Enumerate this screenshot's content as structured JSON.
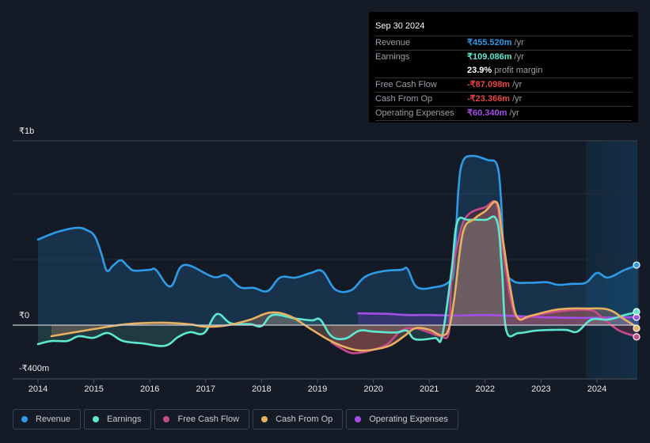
{
  "tooltip": {
    "date": "Sep 30 2024",
    "rows": [
      {
        "label": "Revenue",
        "value": "₹455.520m",
        "unit": "/yr",
        "color": "#2e9be8"
      },
      {
        "label": "Earnings",
        "value": "₹109.086m",
        "unit": "/yr",
        "color": "#5ee8d0"
      },
      {
        "label": "",
        "value": "23.9%",
        "unit": "profit margin",
        "color": "#ffffff"
      },
      {
        "label": "Free Cash Flow",
        "value": "-₹87.098m",
        "unit": "/yr",
        "color": "#e84545"
      },
      {
        "label": "Cash From Op",
        "value": "-₹23.366m",
        "unit": "/yr",
        "color": "#e84545"
      },
      {
        "label": "Operating Expenses",
        "value": "₹60.340m",
        "unit": "/yr",
        "color": "#a44ee8"
      }
    ]
  },
  "legend": [
    {
      "label": "Revenue",
      "color": "#2e9be8"
    },
    {
      "label": "Earnings",
      "color": "#5ee8d0"
    },
    {
      "label": "Free Cash Flow",
      "color": "#c84a8a"
    },
    {
      "label": "Cash From Op",
      "color": "#e8b060"
    },
    {
      "label": "Operating Expenses",
      "color": "#a44ee8"
    }
  ],
  "chart_data": {
    "type": "area",
    "title": "",
    "xlabel": "",
    "ylabel": "",
    "y_tick_labels": [
      "₹1b",
      "₹0",
      "-₹400m"
    ],
    "y_ticks": [
      1000,
      0,
      -400
    ],
    "ylim": [
      -292,
      1000
    ],
    "xlim": [
      2013.55,
      2024.85
    ],
    "x_tick_labels": [
      "2014",
      "2015",
      "2016",
      "2017",
      "2018",
      "2019",
      "2020",
      "2021",
      "2022",
      "2023",
      "2024"
    ],
    "x_ticks": [
      2014,
      2015,
      2016,
      2017,
      2018,
      2019,
      2020,
      2021,
      2022,
      2023,
      2024
    ],
    "forecast_region_start": 2023.8,
    "grid": true,
    "legend_position": "bottom",
    "units": "INR millions",
    "series": [
      {
        "name": "Revenue",
        "color": "#2e9be8",
        "points": [
          [
            2014.0,
            464
          ],
          [
            2014.31,
            502
          ],
          [
            2014.59,
            524
          ],
          [
            2014.73,
            528
          ],
          [
            2014.85,
            519
          ],
          [
            2015.01,
            485
          ],
          [
            2015.13,
            391
          ],
          [
            2015.23,
            296
          ],
          [
            2015.34,
            322
          ],
          [
            2015.48,
            352
          ],
          [
            2015.61,
            318
          ],
          [
            2015.72,
            296
          ],
          [
            2016.0,
            300
          ],
          [
            2016.11,
            300
          ],
          [
            2016.37,
            210
          ],
          [
            2016.61,
            326
          ],
          [
            2017.13,
            262
          ],
          [
            2017.37,
            270
          ],
          [
            2017.61,
            206
          ],
          [
            2017.86,
            202
          ],
          [
            2018.11,
            185
          ],
          [
            2018.33,
            258
          ],
          [
            2018.61,
            258
          ],
          [
            2018.88,
            283
          ],
          [
            2019.09,
            292
          ],
          [
            2019.32,
            193
          ],
          [
            2019.6,
            189
          ],
          [
            2019.85,
            262
          ],
          [
            2020.16,
            292
          ],
          [
            2020.5,
            300
          ],
          [
            2020.61,
            305
          ],
          [
            2020.78,
            206
          ],
          [
            2021.1,
            206
          ],
          [
            2021.34,
            232
          ],
          [
            2021.44,
            305
          ],
          [
            2021.52,
            730
          ],
          [
            2021.6,
            888
          ],
          [
            2021.78,
            918
          ],
          [
            2022.04,
            896
          ],
          [
            2022.21,
            871
          ],
          [
            2022.28,
            700
          ],
          [
            2022.35,
            330
          ],
          [
            2022.5,
            240
          ],
          [
            2022.8,
            230
          ],
          [
            2023.1,
            233
          ],
          [
            2023.3,
            219
          ],
          [
            2023.55,
            224
          ],
          [
            2023.8,
            230
          ],
          [
            2024.0,
            283
          ],
          [
            2024.2,
            258
          ],
          [
            2024.5,
            300
          ],
          [
            2024.75,
            326
          ]
        ]
      },
      {
        "name": "Earnings",
        "color": "#5ee8d0",
        "points": [
          [
            2014.0,
            -103
          ],
          [
            2014.24,
            -86
          ],
          [
            2014.52,
            -86
          ],
          [
            2014.73,
            -60
          ],
          [
            2014.99,
            -69
          ],
          [
            2015.25,
            -43
          ],
          [
            2015.52,
            -86
          ],
          [
            2015.87,
            -99
          ],
          [
            2016.27,
            -112
          ],
          [
            2016.51,
            -64
          ],
          [
            2016.72,
            -38
          ],
          [
            2016.97,
            -43
          ],
          [
            2017.2,
            60
          ],
          [
            2017.45,
            10
          ],
          [
            2017.8,
            5
          ],
          [
            2018.0,
            -5
          ],
          [
            2018.2,
            55
          ],
          [
            2018.6,
            36
          ],
          [
            2018.9,
            26
          ],
          [
            2019.05,
            30
          ],
          [
            2019.25,
            -60
          ],
          [
            2019.5,
            -73
          ],
          [
            2019.75,
            -30
          ],
          [
            2020.0,
            -35
          ],
          [
            2020.4,
            -40
          ],
          [
            2020.6,
            -30
          ],
          [
            2020.75,
            -77
          ],
          [
            2021.1,
            -70
          ],
          [
            2021.23,
            -60
          ],
          [
            2021.4,
            300
          ],
          [
            2021.5,
            558
          ],
          [
            2021.7,
            571
          ],
          [
            2022.0,
            571
          ],
          [
            2022.21,
            567
          ],
          [
            2022.3,
            300
          ],
          [
            2022.38,
            -30
          ],
          [
            2022.6,
            -43
          ],
          [
            2022.9,
            -30
          ],
          [
            2023.2,
            -26
          ],
          [
            2023.45,
            -26
          ],
          [
            2023.65,
            -35
          ],
          [
            2023.9,
            30
          ],
          [
            2024.2,
            30
          ],
          [
            2024.5,
            55
          ],
          [
            2024.75,
            73
          ]
        ]
      },
      {
        "name": "Free Cash Flow",
        "color": "#c84a8a",
        "points": [
          [
            2019.25,
            -94
          ],
          [
            2019.55,
            -146
          ],
          [
            2019.75,
            -150
          ],
          [
            2020.0,
            -133
          ],
          [
            2020.25,
            -103
          ],
          [
            2020.5,
            -30
          ],
          [
            2020.75,
            -17
          ],
          [
            2021.0,
            -40
          ],
          [
            2021.2,
            -60
          ],
          [
            2021.35,
            -40
          ],
          [
            2021.4,
            250
          ],
          [
            2021.55,
            500
          ],
          [
            2021.7,
            600
          ],
          [
            2022.0,
            640
          ],
          [
            2022.2,
            660
          ],
          [
            2022.3,
            450
          ],
          [
            2022.45,
            150
          ],
          [
            2022.6,
            40
          ],
          [
            2023.0,
            60
          ],
          [
            2023.5,
            80
          ],
          [
            2023.9,
            80
          ],
          [
            2024.1,
            40
          ],
          [
            2024.4,
            -30
          ],
          [
            2024.75,
            -64
          ]
        ]
      },
      {
        "name": "Cash From Op",
        "color": "#e8b060",
        "points": [
          [
            2014.24,
            -60
          ],
          [
            2015.01,
            -21
          ],
          [
            2015.58,
            5
          ],
          [
            2016.21,
            13
          ],
          [
            2016.7,
            5
          ],
          [
            2017.01,
            -9
          ],
          [
            2017.4,
            0
          ],
          [
            2017.8,
            30
          ],
          [
            2018.15,
            68
          ],
          [
            2018.5,
            50
          ],
          [
            2018.9,
            -25
          ],
          [
            2019.2,
            -80
          ],
          [
            2019.5,
            -120
          ],
          [
            2019.75,
            -137
          ],
          [
            2020.0,
            -133
          ],
          [
            2020.3,
            -110
          ],
          [
            2020.55,
            -60
          ],
          [
            2020.75,
            -17
          ],
          [
            2021.0,
            -25
          ],
          [
            2021.22,
            -55
          ],
          [
            2021.35,
            -20
          ],
          [
            2021.45,
            150
          ],
          [
            2021.6,
            500
          ],
          [
            2021.8,
            575
          ],
          [
            2022.0,
            618
          ],
          [
            2022.21,
            665
          ],
          [
            2022.3,
            500
          ],
          [
            2022.45,
            200
          ],
          [
            2022.58,
            40
          ],
          [
            2022.8,
            50
          ],
          [
            2023.2,
            80
          ],
          [
            2023.5,
            90
          ],
          [
            2023.8,
            90
          ],
          [
            2024.2,
            85
          ],
          [
            2024.5,
            30
          ],
          [
            2024.75,
            -17
          ]
        ]
      },
      {
        "name": "Operating Expenses",
        "color": "#a44ee8",
        "points": [
          [
            2019.73,
            64
          ],
          [
            2020.2,
            62
          ],
          [
            2020.6,
            55
          ],
          [
            2021.0,
            55
          ],
          [
            2021.5,
            52
          ],
          [
            2022.0,
            55
          ],
          [
            2022.5,
            50
          ],
          [
            2023.0,
            43
          ],
          [
            2023.5,
            40
          ],
          [
            2024.0,
            40
          ],
          [
            2024.4,
            42
          ],
          [
            2024.75,
            43
          ]
        ]
      }
    ]
  }
}
